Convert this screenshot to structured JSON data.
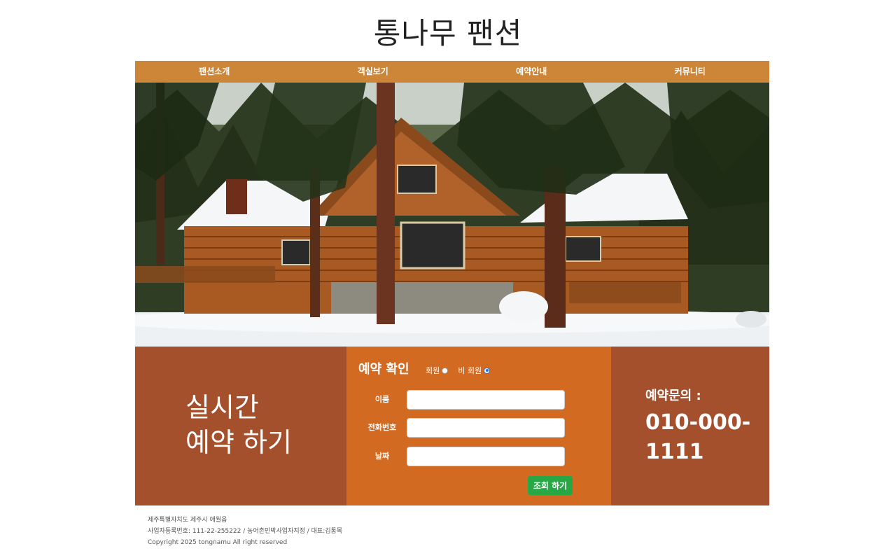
{
  "header": {
    "title": "통나무 팬션"
  },
  "nav": {
    "items": [
      "팬션소개",
      "객실보기",
      "예약안내",
      "커뮤니티"
    ]
  },
  "hero": {
    "description": "snowy log cabin in pine forest"
  },
  "reservation_left": {
    "line1": "실시간",
    "line2": "예약 하기"
  },
  "reservation_form": {
    "title": "예약 확인",
    "radio_member": "회원",
    "radio_nonmember": "비 회원",
    "selected": "비 회원",
    "fields": [
      {
        "label": "이름",
        "value": "",
        "placeholder": ""
      },
      {
        "label": "전화번호",
        "value": "",
        "placeholder": ""
      },
      {
        "label": "날짜",
        "value": "",
        "placeholder": ""
      }
    ],
    "submit": "조회 하기"
  },
  "contact": {
    "label": "예약문의 :",
    "number": "010-000-1111"
  },
  "footer": {
    "address": "제주특별자치도 제주시 애월읍",
    "business": "사업자등록번호: 111-22-255222 / 농어촌민박사업자지정 / 대표:김통목",
    "copyright": "Copyright 2025 tongnamu All right reserved"
  },
  "colors": {
    "nav": "#cd8538",
    "panel_side": "#a4502c",
    "panel_mid": "#d26a21",
    "button": "#28a745"
  }
}
